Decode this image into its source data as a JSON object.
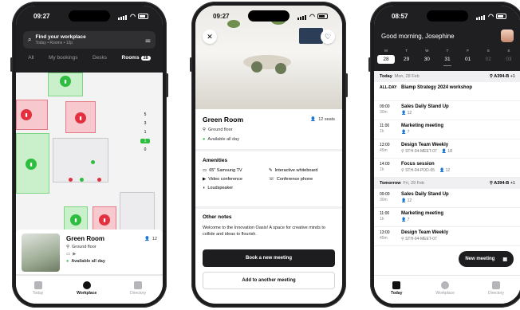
{
  "phone1": {
    "time": "09:27",
    "search": {
      "title": "Find your workplace",
      "subtitle": "Today • Rooms • 12p"
    },
    "tabs": [
      {
        "label": "All"
      },
      {
        "label": "My bookings"
      },
      {
        "label": "Desks"
      },
      {
        "label": "Rooms",
        "count": "28"
      }
    ],
    "map_numbers": [
      "5",
      "3",
      "1",
      "0"
    ],
    "map_highlight": "1",
    "room_card": {
      "name": "Green Room",
      "capacity": "12",
      "location": "Ground floor",
      "availability": "Available all day"
    },
    "nav": [
      {
        "label": "Today"
      },
      {
        "label": "Workplace"
      },
      {
        "label": "Directory"
      }
    ]
  },
  "phone2": {
    "time": "09:27",
    "room_name": "Green Room",
    "seats": "12 seats",
    "location": "Ground floor",
    "availability": "Available all day",
    "amenities_title": "Amenities",
    "amenities": [
      {
        "label": "65\" Samsung TV",
        "icon": "tv-icon"
      },
      {
        "label": "Interactive whiteboard",
        "icon": "whiteboard-icon"
      },
      {
        "label": "Video conference",
        "icon": "video-icon"
      },
      {
        "label": "Conference phone",
        "icon": "phone-icon"
      },
      {
        "label": "Loudspeaker",
        "icon": "speaker-icon"
      }
    ],
    "notes_title": "Other notes",
    "notes": "Welcome to the Innovation Oasis! A space for creative minds to collide and ideas to flourish.",
    "primary_button": "Book a new meeting",
    "secondary_button": "Add to another meeting"
  },
  "phone3": {
    "time": "08:57",
    "greeting": "Good morning, Josephine",
    "week": [
      {
        "d": "M",
        "n": "28",
        "selected": true
      },
      {
        "d": "T",
        "n": "29"
      },
      {
        "d": "W",
        "n": "30"
      },
      {
        "d": "T",
        "n": "31"
      },
      {
        "d": "F",
        "n": "01"
      },
      {
        "d": "S",
        "n": "02",
        "dim": true
      },
      {
        "d": "S",
        "n": "03",
        "dim": true
      }
    ],
    "today_header": {
      "label": "Today",
      "date": "Mon, 28 Feb",
      "location": "A394-B",
      "extra": "+1"
    },
    "today_events": [
      {
        "time": "ALL-DAY",
        "dur": "",
        "title": "Biamp Strategy 2024 workshop",
        "loc": "",
        "people": ""
      },
      {
        "time": "09:00",
        "dur": "30m",
        "title": "Sales Daily Stand Up",
        "loc": "",
        "people": "12"
      },
      {
        "time": "11:00",
        "dur": "1h",
        "title": "Marketing meeting",
        "loc": "",
        "people": "7"
      },
      {
        "time": "13:00",
        "dur": "45m",
        "title": "Design Team Weekly",
        "loc": "STH-04-MEET-07",
        "people": "18"
      },
      {
        "time": "14:00",
        "dur": "1h",
        "title": "Focus session",
        "loc": "STH-04-POD-05",
        "people": "12"
      }
    ],
    "tomorrow_header": {
      "label": "Tomorrow",
      "date": "Fri, 29 Feb",
      "location": "A394-B",
      "extra": "+1"
    },
    "tomorrow_events": [
      {
        "time": "09:00",
        "dur": "30m",
        "title": "Sales Daily Stand Up",
        "loc": "",
        "people": "12"
      },
      {
        "time": "11:00",
        "dur": "1h",
        "title": "Marketing meeting",
        "loc": "",
        "people": "7"
      },
      {
        "time": "13:00",
        "dur": "45m",
        "title": "Design Team Weekly",
        "loc": "STH-04-MEET-07",
        "people": ""
      }
    ],
    "fab": "New meeting",
    "nav": [
      {
        "label": "Today"
      },
      {
        "label": "Workplace"
      },
      {
        "label": "Directory"
      }
    ]
  }
}
